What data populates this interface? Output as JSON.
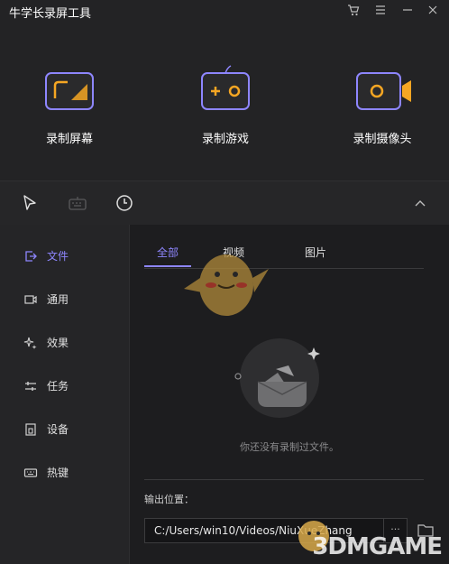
{
  "window": {
    "title": "牛学长录屏工具"
  },
  "titlebar_icons": [
    "cart-icon",
    "menu-icon",
    "minimize-icon",
    "close-icon"
  ],
  "modes": [
    {
      "label": "录制屏幕",
      "icon": "screen-record-icon"
    },
    {
      "label": "录制游戏",
      "icon": "game-record-icon"
    },
    {
      "label": "录制摄像头",
      "icon": "camera-record-icon"
    }
  ],
  "toolbar": {
    "icons": [
      "cursor-icon",
      "keyboard-icon",
      "clock-icon",
      "collapse-chevron-icon"
    ]
  },
  "sidebar": {
    "items": [
      {
        "label": "文件",
        "icon": "file-export-icon",
        "active": true
      },
      {
        "label": "通用",
        "icon": "video-camera-icon"
      },
      {
        "label": "效果",
        "icon": "sparkle-icon"
      },
      {
        "label": "任务",
        "icon": "sliders-icon"
      },
      {
        "label": "设备",
        "icon": "device-icon"
      },
      {
        "label": "热键",
        "icon": "keyboard-icon"
      }
    ]
  },
  "main": {
    "tabs": [
      {
        "label": "全部",
        "active": true
      },
      {
        "label": "视频"
      },
      {
        "label": "图片"
      }
    ],
    "empty_text": "你还没有录制过文件。",
    "output_label": "输出位置：",
    "output_path": "C:/Users/win10/Videos/NiuXueZhang",
    "browse_label": "···"
  },
  "watermark": {
    "text": "3DMGAME"
  },
  "colors": {
    "accent": "#8e86ff",
    "orange": "#f5a623",
    "bg": "#1d1d1f",
    "panel": "#232325"
  }
}
